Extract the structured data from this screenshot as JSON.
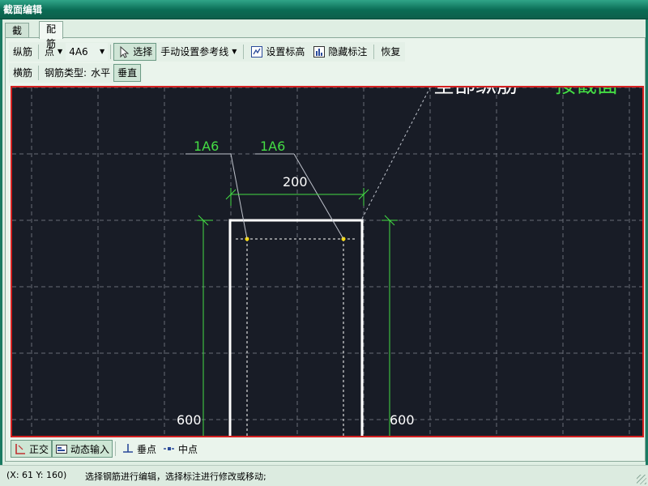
{
  "window": {
    "title": "截面编辑"
  },
  "tabs": [
    {
      "label": "截面"
    },
    {
      "label": "配筋"
    }
  ],
  "toolbar1": {
    "zongjin": "纵筋",
    "mode_value": "点",
    "rebar_value": "4A6",
    "select_label": "选择",
    "manual_ref_label": "手动设置参考线",
    "set_elevation_label": "设置标高",
    "hide_annotation_label": "隐藏标注",
    "restore_label": "恢复"
  },
  "toolbar2": {
    "hengjin": "横筋",
    "rebar_type_label": "钢筋类型:",
    "horizontal_label": "水平",
    "vertical_label": "垂直"
  },
  "canvas": {
    "top_text_white": "全部纵筋",
    "top_text_green": "按截面",
    "label_left": "1A6",
    "label_right": "1A6",
    "dim_width": "200",
    "dim_height_left": "600",
    "dim_height_right": "600",
    "colors": {
      "background": "#181c26",
      "section": "#ffffff",
      "annotation": "#44dd44",
      "grid": "#8a8f99",
      "border": "#d42020"
    }
  },
  "bottombar": {
    "ortho_label": "正交",
    "dynamic_input_label": "动态输入",
    "perpendicular_label": "垂点",
    "midpoint_label": "中点"
  },
  "status": {
    "coords": "(X: 61 Y: 160)",
    "message": "选择钢筋进行编辑，选择标注进行修改或移动;"
  }
}
